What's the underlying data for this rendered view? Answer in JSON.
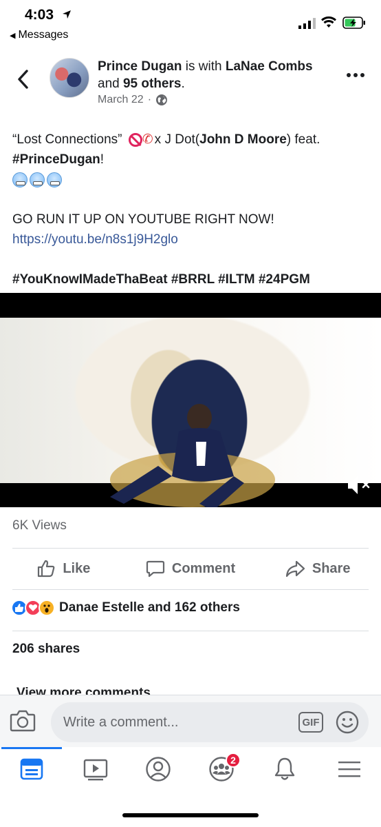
{
  "status": {
    "time": "4:03",
    "back_label": "Messages"
  },
  "post": {
    "author": "Prince Dugan",
    "with_text": "is with",
    "tagged": "LaNae Combs",
    "and_text": "and",
    "others": "95 others",
    "period": ".",
    "date": "March 22",
    "privacy_sep": "·"
  },
  "body": {
    "line1_a": "“Lost Connections” ",
    "line1_b": "x J Dot(",
    "line1_bold": "John D Moore",
    "line1_c": ") feat.",
    "line2_bold": "#PrinceDugan",
    "line2_c": "!",
    "line4": "GO RUN IT UP ON YOUTUBE RIGHT NOW!",
    "link": "https://youtu.be/n8s1j9H2glo",
    "hashtags": "#YouKnowIMadeThaBeat #BRRL #ILTM #24PGM"
  },
  "video": {
    "muted": true
  },
  "stats": {
    "views": "6K Views",
    "reactions_label": "Danae Estelle and 162 others",
    "shares": "206 shares",
    "view_more": "View more comments"
  },
  "actions": {
    "like": "Like",
    "comment": "Comment",
    "share": "Share"
  },
  "composer": {
    "placeholder": "Write a comment...",
    "gif": "GIF"
  },
  "tabs": {
    "groups_badge": "2"
  },
  "colors": {
    "accent": "#1877f2",
    "link": "#385898",
    "badge": "#e41e3f"
  }
}
